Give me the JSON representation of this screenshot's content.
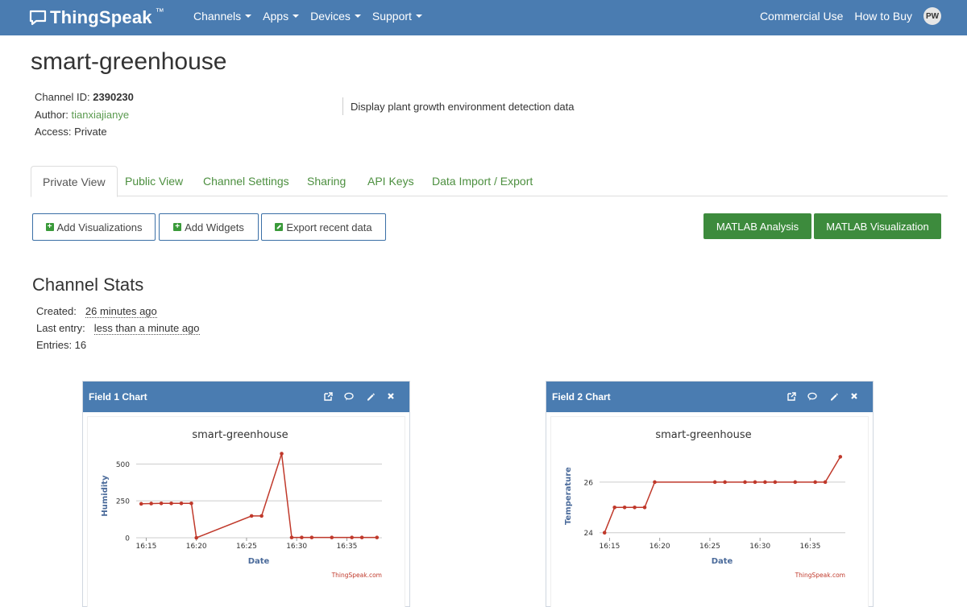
{
  "navbar": {
    "brand": "ThingSpeak",
    "brand_tm": "™",
    "menus": [
      "Channels",
      "Apps",
      "Devices",
      "Support"
    ],
    "right_links": [
      "Commercial Use",
      "How to Buy"
    ],
    "avatar_initials": "PW"
  },
  "channel": {
    "title": "smart-greenhouse",
    "id_label": "Channel ID:",
    "id_value": "2390230",
    "author_label": "Author:",
    "author_value": "tianxiajianye",
    "access_label": "Access:",
    "access_value": "Private",
    "description": "Display plant growth environment detection data"
  },
  "tabs": [
    "Private View",
    "Public View",
    "Channel Settings",
    "Sharing",
    "API Keys",
    "Data Import / Export"
  ],
  "actions": {
    "add_visualizations": "Add Visualizations",
    "add_widgets": "Add Widgets",
    "export": "Export recent data",
    "matlab_analysis": "MATLAB Analysis",
    "matlab_visualization": "MATLAB Visualization"
  },
  "stats": {
    "title": "Channel Stats",
    "created_label": "Created:",
    "created_value": "26 minutes ago",
    "last_label": "Last entry:",
    "last_value": "less than a minute ago",
    "entries": "Entries: 16"
  },
  "panels": [
    {
      "title": "Field 1 Chart"
    },
    {
      "title": "Field 2 Chart"
    }
  ],
  "colors": {
    "nav": "#4a7cb1",
    "green": "#3d8b3d",
    "series": "#c0392b",
    "link": "#5a9a4f"
  },
  "chart_data": [
    {
      "type": "line",
      "title": "smart-greenhouse",
      "xlabel": "Date",
      "ylabel": "Humidity",
      "credit": "ThingSpeak.com",
      "xticks": [
        "16:15",
        "16:20",
        "16:25",
        "16:30",
        "16:35"
      ],
      "yticks": [
        0,
        250,
        500
      ],
      "ylim": [
        0,
        600
      ],
      "x": [
        "16:14.5",
        "16:15.5",
        "16:16.5",
        "16:17.5",
        "16:18.5",
        "16:19.5",
        "16:20.0",
        "16:25.5",
        "16:26.5",
        "16:28.5",
        "16:29.5",
        "16:30.5",
        "16:31.5",
        "16:33.5",
        "16:35.5",
        "16:36.5",
        "16:38.0"
      ],
      "values": [
        230,
        232,
        233,
        233,
        233,
        233,
        0,
        148,
        148,
        570,
        2,
        2,
        2,
        2,
        2,
        2,
        2
      ]
    },
    {
      "type": "line",
      "title": "smart-greenhouse",
      "xlabel": "Date",
      "ylabel": "Temperature",
      "credit": "ThingSpeak.com",
      "xticks": [
        "16:15",
        "16:20",
        "16:25",
        "16:30",
        "16:35"
      ],
      "yticks": [
        24,
        26
      ],
      "ylim": [
        23.8,
        27.3
      ],
      "x": [
        "16:14.5",
        "16:15.5",
        "16:16.5",
        "16:17.5",
        "16:18.5",
        "16:19.5",
        "16:25.5",
        "16:26.5",
        "16:28.5",
        "16:29.5",
        "16:30.5",
        "16:31.5",
        "16:33.5",
        "16:35.5",
        "16:36.5",
        "16:38.0"
      ],
      "values": [
        24.0,
        25.0,
        25.0,
        25.0,
        25.0,
        26.0,
        26.0,
        26.0,
        26.0,
        26.0,
        26.0,
        26.0,
        26.0,
        26.0,
        26.0,
        27.0
      ]
    }
  ]
}
